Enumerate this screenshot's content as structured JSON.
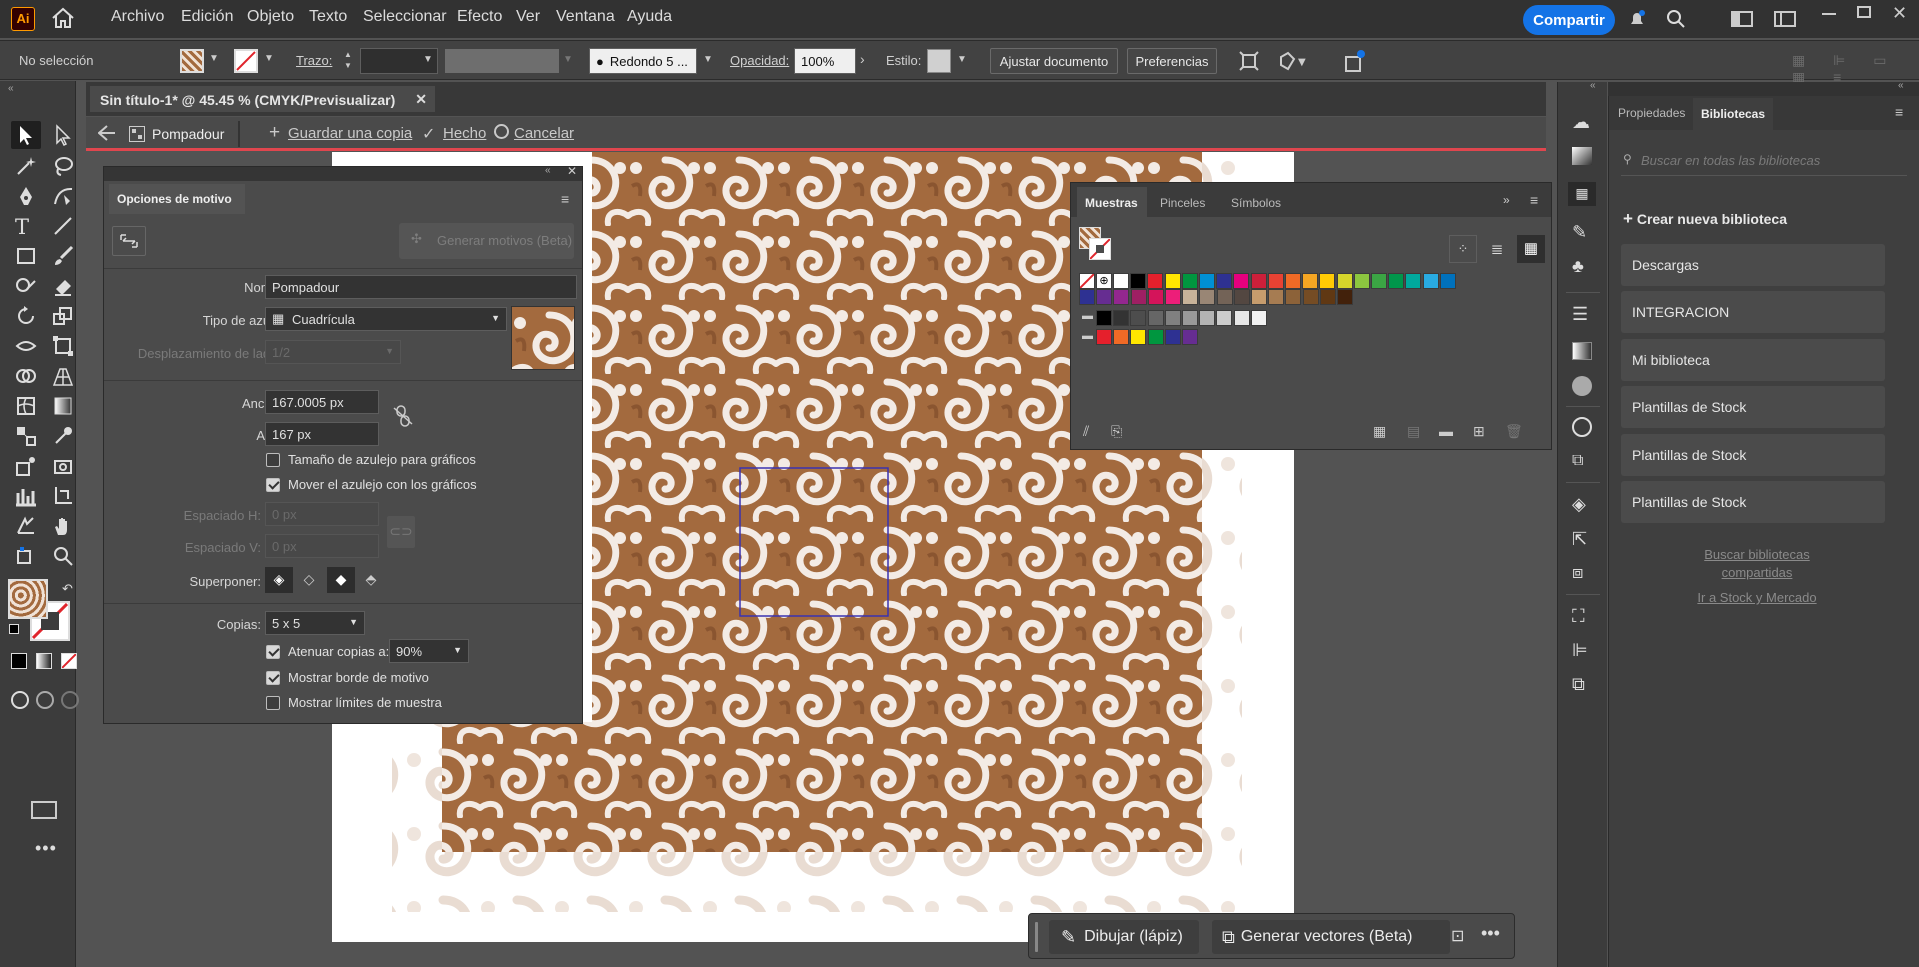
{
  "app": {
    "logo": "Ai"
  },
  "menu": [
    "Archivo",
    "Edición",
    "Objeto",
    "Texto",
    "Seleccionar",
    "Efecto",
    "Ver",
    "Ventana",
    "Ayuda"
  ],
  "header": {
    "share": "Compartir"
  },
  "control": {
    "selection": "No selección",
    "stroke_label": "Trazo:",
    "brush": "Redondo 5 ...",
    "opacity_label": "Opacidad:",
    "opacity": "100%",
    "style_label": "Estilo:",
    "fit_doc": "Ajustar documento",
    "prefs": "Preferencias"
  },
  "doc": {
    "tab_title": "Sin título-1* @ 45.45 % (CMYK/Previsualizar)"
  },
  "pattern_bar": {
    "name": "Pompadour",
    "save_copy": "Guardar una copia",
    "done": "Hecho",
    "cancel": "Cancelar"
  },
  "pattern_panel": {
    "title": "Opciones de motivo",
    "generate": "Generar motivos (Beta)",
    "name_label": "Nombre:",
    "name": "Pompadour",
    "tile_type_label": "Tipo de azulejo:",
    "tile_type": "Cuadrícula",
    "brick_label": "Desplazamiento de ladrillo:",
    "brick": "1/2",
    "width_label": "Anchura:",
    "width": "167.0005 px",
    "height_label": "Altura:",
    "height": "167 px",
    "opt_tile_size": "Tamaño de azulejo para gráficos",
    "opt_move_tile": "Mover el azulejo con los gráficos",
    "hspace_label": "Espaciado H:",
    "hspace": "0 px",
    "vspace_label": "Espaciado V:",
    "vspace": "0 px",
    "overlap_label": "Superponer:",
    "copies_label": "Copias:",
    "copies": "5 x 5",
    "dim_label": "Atenuar copias a:",
    "dim": "90%",
    "show_edge": "Mostrar borde de motivo",
    "show_bounds": "Mostrar límites de muestra"
  },
  "swatches": {
    "tabs": [
      "Muestras",
      "Pinceles",
      "Símbolos"
    ],
    "row1": [
      "#ffffff",
      "#000000",
      "#e5202c",
      "#ffe600",
      "#00963f",
      "#0090d4",
      "#2e3192",
      "#e6007e",
      "#cc1f3a",
      "#e84233",
      "#f06a26",
      "#f5a623",
      "#ffcb05",
      "#d6d62b",
      "#8cc63f",
      "#3ba544",
      "#00964b",
      "#00a99d",
      "#29abe2",
      "#0071bc"
    ],
    "row2": [
      "#2e3192",
      "#662d91",
      "#93278f",
      "#9e1f63",
      "#d4145a",
      "#ed1e79",
      "#c7b299",
      "#998675",
      "#736357",
      "#534741",
      "#c69c6d",
      "#a67c52",
      "#8c6239",
      "#754c24",
      "#603813",
      "#42210b"
    ],
    "gray": [
      "#000000",
      "#333333",
      "#4d4d4d",
      "#666666",
      "#808080",
      "#999999",
      "#b3b3b3",
      "#cccccc",
      "#e6e6e6",
      "#f2f2f2"
    ],
    "group": [
      "#e5202c",
      "#f06a26",
      "#ffe600",
      "#00963f",
      "#2e3192",
      "#662d91"
    ]
  },
  "libraries": {
    "tabs": [
      "Propiedades",
      "Bibliotecas"
    ],
    "search_placeholder": "Buscar en todas las bibliotecas",
    "create": "Crear nueva biblioteca",
    "items": [
      "Descargas",
      "INTEGRACION",
      "Mi biblioteca",
      "Plantillas de Stock",
      "Plantillas de Stock",
      "Plantillas de Stock"
    ],
    "link_shared": "Buscar bibliotecas compartidas",
    "link_stock": "Ir a Stock y Mercado"
  },
  "bottom": {
    "draw": "Dibujar (lápiz)",
    "generate": "Generar vectores (Beta)"
  },
  "colors": {
    "accent": "#1473e6",
    "pattern": "#a36a3e",
    "pattern_light": "#e9dcd2",
    "tile_border": "#3a32b0"
  }
}
